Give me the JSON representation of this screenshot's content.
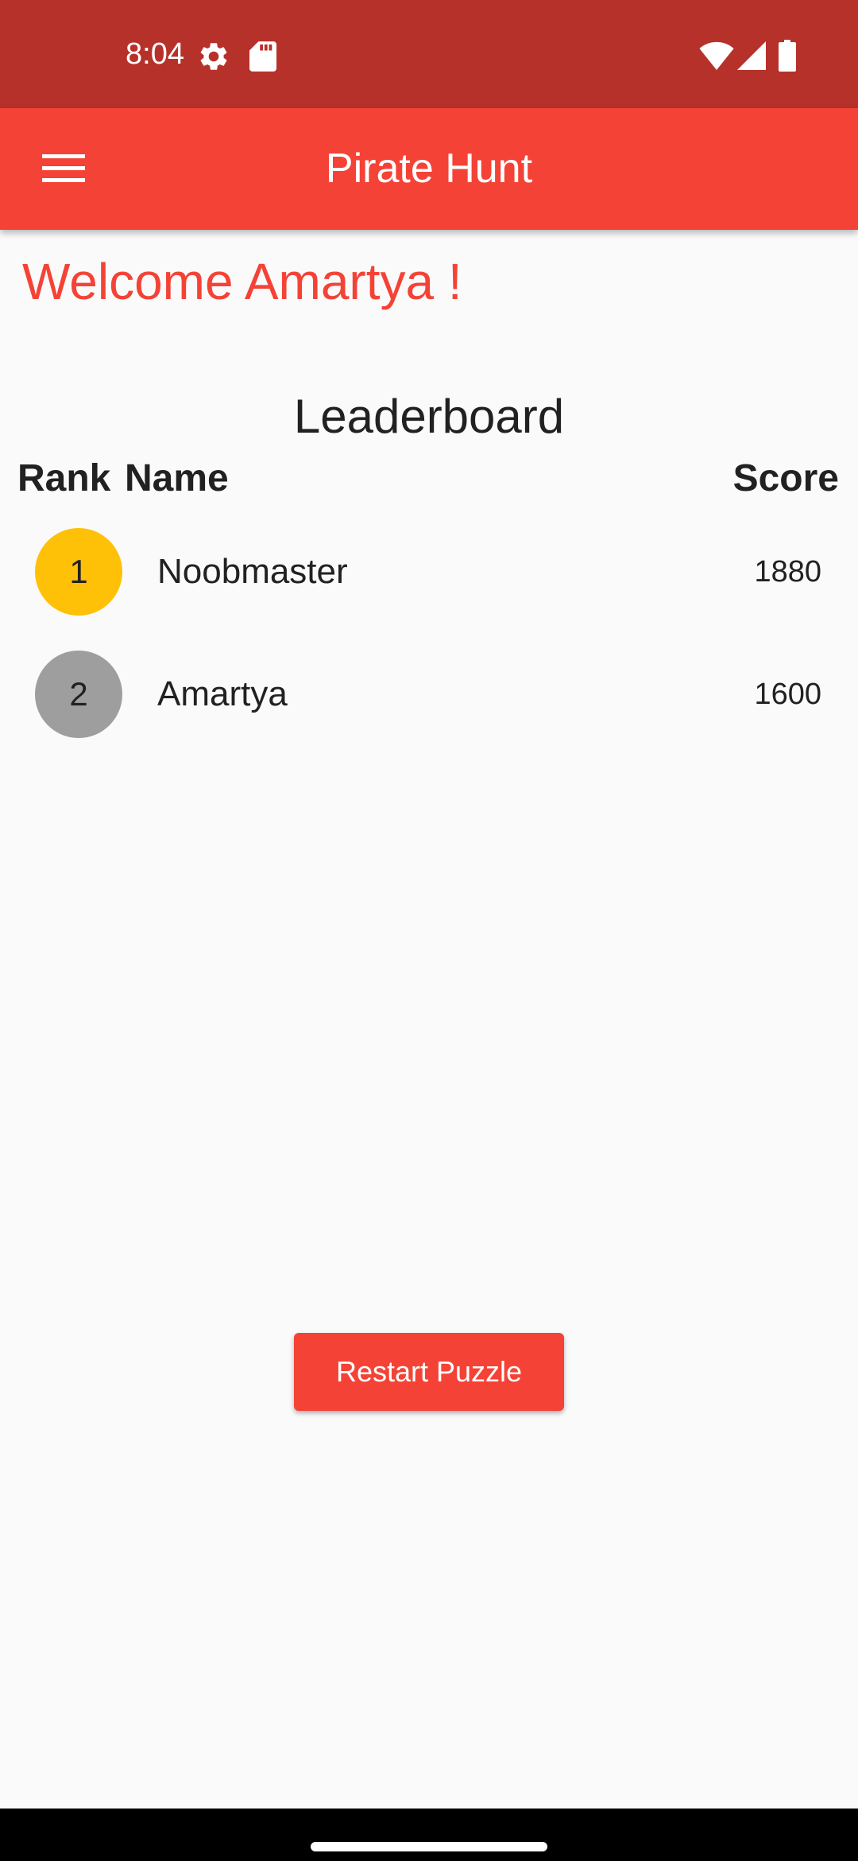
{
  "status_bar": {
    "time": "8:04",
    "icons": [
      "settings-icon",
      "sd-card-icon",
      "wifi-icon",
      "signal-icon",
      "battery-icon"
    ]
  },
  "app_bar": {
    "title": "Pirate Hunt",
    "menu_icon": "hamburger-menu-icon"
  },
  "welcome_text": "Welcome Amartya !",
  "leaderboard": {
    "title": "Leaderboard",
    "headers": {
      "rank": "Rank",
      "name": "Name",
      "score": "Score"
    },
    "rows": [
      {
        "rank": "1",
        "name": "Noobmaster",
        "score": "1880",
        "badge_color": "#ffc107"
      },
      {
        "rank": "2",
        "name": "Amartya",
        "score": "1600",
        "badge_color": "#9e9e9e"
      }
    ]
  },
  "restart_button": {
    "label": "Restart Puzzle"
  },
  "colors": {
    "status_bar": "#b7312b",
    "app_bar": "#f44336",
    "accent": "#f44336",
    "background": "#fafafa"
  }
}
